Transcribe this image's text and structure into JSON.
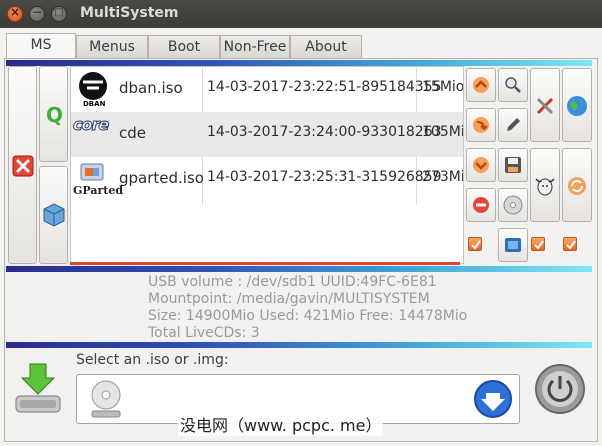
{
  "window": {
    "title": "MultiSystem",
    "close": "×",
    "minimize": "−",
    "maximize": "□"
  },
  "tabs": [
    {
      "label": "MS"
    },
    {
      "label": "Menus"
    },
    {
      "label": "Boot"
    },
    {
      "label": "Non-Free"
    },
    {
      "label": "About"
    }
  ],
  "entries": [
    {
      "logo_text": "DBAN",
      "name": "dban.iso",
      "date": "14-03-2017-23:22:51-895184355",
      "size": "15Mio"
    },
    {
      "logo_text": "core",
      "name": "cde",
      "date": "14-03-2017-23:24:00-933018263",
      "size": "105Mi"
    },
    {
      "logo_text": "GParted",
      "name": "gparted.iso",
      "date": "14-03-2017-23:25:31-315926859",
      "size": "273Mi"
    }
  ],
  "side_buttons": {
    "q_letter": "Q"
  },
  "info": {
    "usb_volume": "USB volume : /dev/sdb1 UUID:49FC-6E81",
    "mountpoint": "Mountpoint: /media/gavin/MULTISYSTEM",
    "size": "Size: 14900Mio Used: 421Mio Free: 14478Mio",
    "total": "Total LiveCDs: 3"
  },
  "select": {
    "label": "Select an .iso or .img:"
  },
  "watermark": "没电网（www. pcpc. me）",
  "colors": {
    "accent_orange": "#e8692a",
    "bar_start": "#2a2a8c",
    "bar_end": "#7de8f2",
    "progress_red": "#e0462c"
  }
}
